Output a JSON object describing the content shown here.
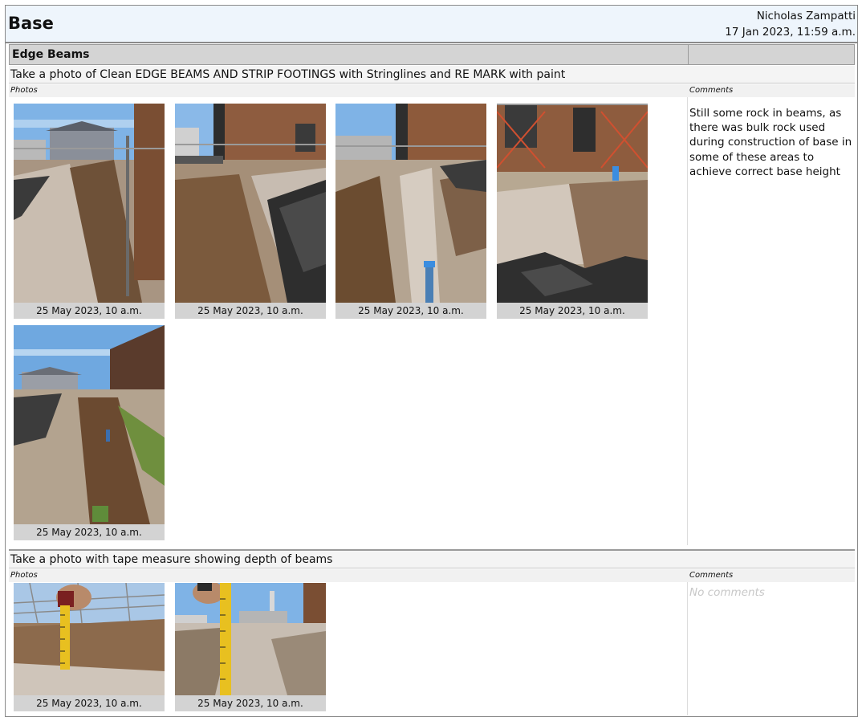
{
  "report": {
    "title": "Base",
    "author": "Nicholas Zampatti",
    "date": "17 Jan 2023, 11:59 a.m."
  },
  "section": {
    "title": "Edge Beams"
  },
  "labels": {
    "photos": "Photos",
    "comments": "Comments"
  },
  "questions": [
    {
      "text": "Take a photo of Clean EDGE BEAMS AND STRIP FOOTINGS with Stringlines and RE MARK with paint",
      "photos": [
        {
          "caption": "25 May 2023, 10 a.m."
        },
        {
          "caption": "25 May 2023, 10 a.m."
        },
        {
          "caption": "25 May 2023, 10 a.m."
        },
        {
          "caption": "25 May 2023, 10 a.m."
        },
        {
          "caption": "25 May 2023, 10 a.m."
        }
      ],
      "comment": "Still some rock in beams, as there was bulk rock used during construction of base in some of these areas to achieve correct base height"
    },
    {
      "text": "Take a photo with tape measure showing depth of beams",
      "photos": [
        {
          "caption": "25 May 2023, 10 a.m."
        },
        {
          "caption": "25 May 2023, 10 a.m."
        }
      ],
      "comment": "No comments"
    }
  ],
  "colors": {
    "header_bg": "#eef5fc",
    "section_bg": "#d4d4d4",
    "caption_bg": "#d3d3d3",
    "sky": "#7fb3e6",
    "soil": "#9c8064",
    "brick": "#8a5a3c",
    "tarp": "#3d3d3d",
    "tape": "#e8c020"
  }
}
